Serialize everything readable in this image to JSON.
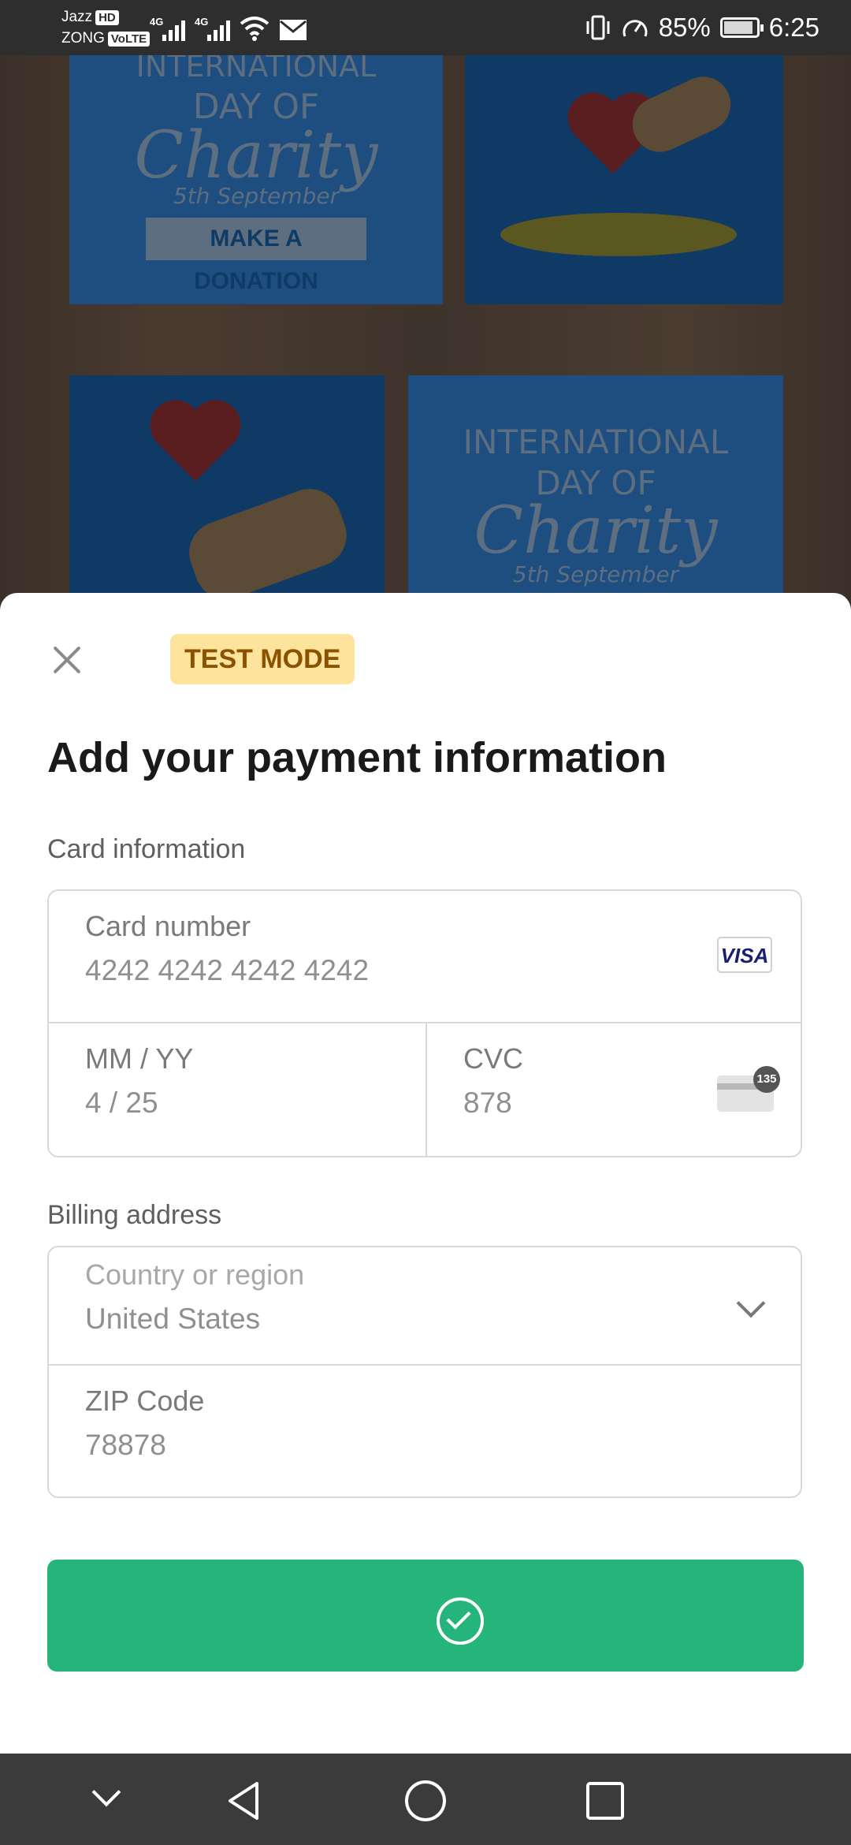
{
  "status_bar": {
    "carrier1": "Jazz",
    "carrier1_tag": "HD",
    "carrier2": "ZONG",
    "carrier2_tag": "VoLTE",
    "network1": "4G",
    "network2": "4G",
    "battery": "85%",
    "time": "6:25"
  },
  "background": {
    "card1": {
      "line1": "INTERNATIONAL",
      "line2": "DAY OF",
      "line3": "Charity",
      "line4": "5th September",
      "banner": "MAKE A DONATION"
    },
    "card2": {
      "line1": "INTERNATIONAL",
      "line2": "DAY OF",
      "line3": "Charity",
      "line4": "5th September"
    }
  },
  "sheet": {
    "badge": "TEST MODE",
    "title": "Add your payment information",
    "card_section_label": "Card information",
    "card_number": {
      "label": "Card number",
      "value": "4242 4242 4242 4242",
      "brand": "VISA"
    },
    "expiry": {
      "label": "MM / YY",
      "value": "4 / 25"
    },
    "cvc": {
      "label": "CVC",
      "value": "878",
      "icon_number": "135"
    },
    "billing_section_label": "Billing address",
    "country": {
      "label": "Country or region",
      "value": "United States"
    },
    "zip": {
      "label": "ZIP Code",
      "value": "78878"
    },
    "pay_button_color": "#25b57a"
  },
  "nav_bar": {
    "icons": [
      "chevron-down-icon",
      "back-icon",
      "home-icon",
      "recents-icon"
    ]
  }
}
